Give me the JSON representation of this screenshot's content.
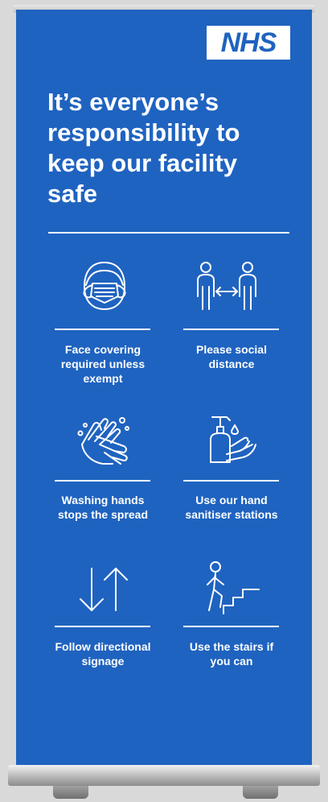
{
  "logo": {
    "text": "NHS"
  },
  "headline": "It’s everyone’s responsibility to keep our facility safe",
  "items": [
    {
      "icon": "face-mask-icon",
      "label": "Face covering required unless exempt"
    },
    {
      "icon": "social-distance-icon",
      "label": "Please social distance"
    },
    {
      "icon": "hand-washing-icon",
      "label": "Washing hands stops the spread"
    },
    {
      "icon": "hand-sanitiser-icon",
      "label": "Use our hand sanitiser stations"
    },
    {
      "icon": "directional-arrows-icon",
      "label": "Follow directional signage"
    },
    {
      "icon": "stairs-icon",
      "label": "Use the stairs if you can"
    }
  ],
  "colors": {
    "banner": "#1f63c0",
    "text": "#ffffff",
    "background": "#d9d9d9"
  }
}
